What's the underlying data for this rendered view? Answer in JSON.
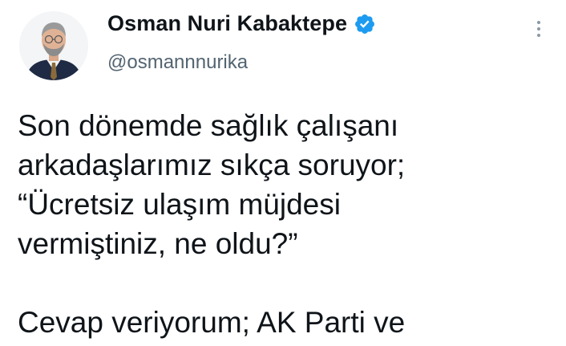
{
  "author": {
    "display_name": "Osman Nuri Kabaktepe",
    "handle": "@osmannnurika",
    "verified_icon": "verified-badge-icon",
    "avatar_icon": "profile-photo"
  },
  "menu": {
    "icon": "more-vertical-icon"
  },
  "tweet": {
    "lines": [
      "Son dönemde sağlık çalışanı",
      "arkadaşlarımız sıkça soruyor;",
      "“Ücretsiz ulaşım müjdesi",
      "vermiştiniz, ne oldu?”",
      "Cevap veriyorum; AK Parti ve"
    ]
  },
  "colors": {
    "text": "#0f1419",
    "secondary_text": "#536471",
    "verified_blue": "#1d9bf0"
  }
}
